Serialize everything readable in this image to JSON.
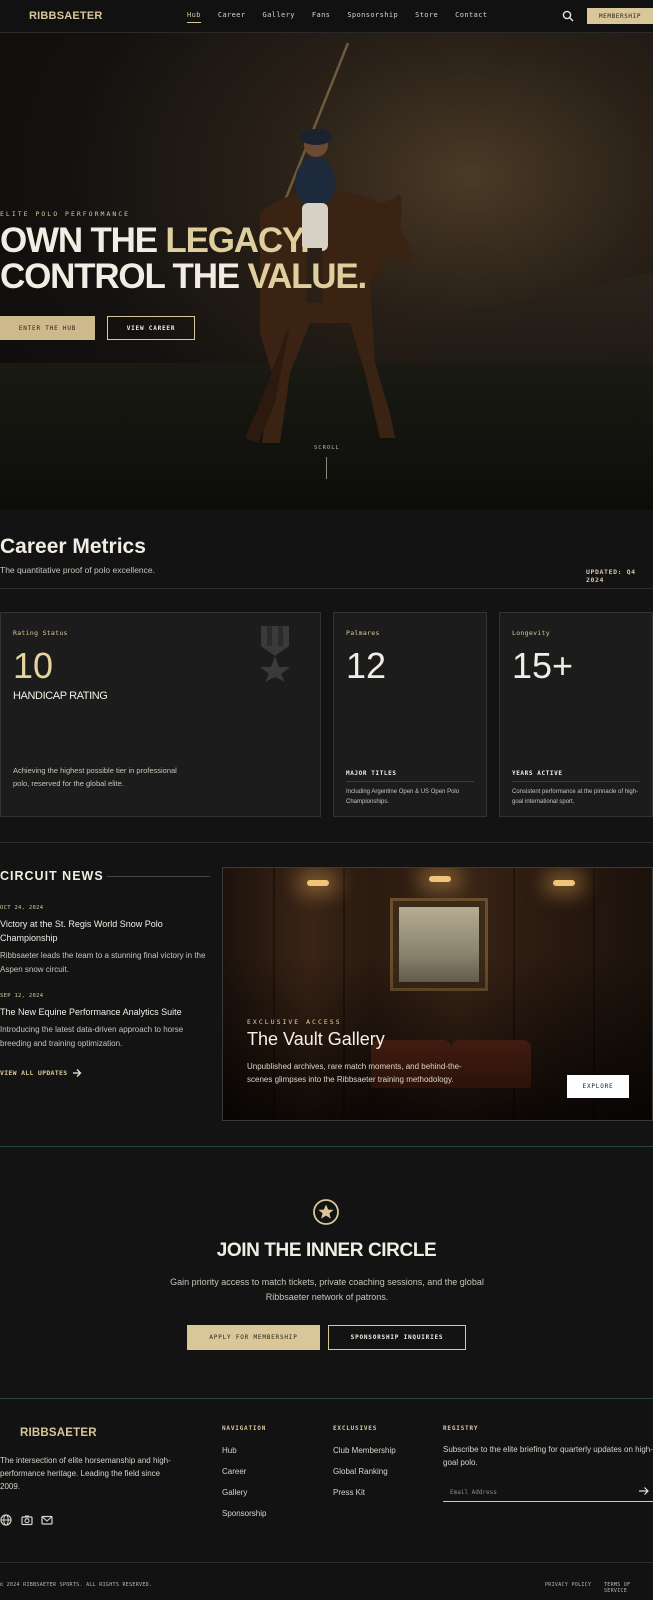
{
  "nav": {
    "brand": "RIBBSAETER",
    "links": [
      "Hub",
      "Career",
      "Gallery",
      "Fans",
      "Sponsorship",
      "Store",
      "Contact"
    ],
    "active_link": "Hub",
    "membership_label": "MEMBERSHIP",
    "search_icon": "search-icon"
  },
  "hero": {
    "eyebrow": "ELITE POLO PERFORMANCE",
    "title_line1_a": "OWN THE ",
    "title_line1_b": "LEGACY.",
    "title_line2_a": "CONTROL THE ",
    "title_line2_b": "VALUE.",
    "primary_cta": "ENTER THE HUB",
    "secondary_cta": "VIEW CAREER",
    "scroll_label": "SCROLL"
  },
  "metrics": {
    "title": "Career Metrics",
    "subtitle": "The quantitative proof of polo excellence.",
    "updated": "UPDATED: Q4 2024",
    "cards": [
      {
        "label": "Rating Status",
        "value": "10",
        "sublabel": "HANDICAP RATING",
        "description": "Achieving the highest possible tier in professional polo, reserved for the global elite.",
        "icon": "medal-icon"
      },
      {
        "label": "Palmares",
        "value": "12",
        "foot_title": "MAJOR TITLES",
        "foot_desc": "Including Argentine Open & US Open Polo Championships."
      },
      {
        "label": "Longevity",
        "value": "15+",
        "foot_title": "YEARS ACTIVE",
        "foot_desc": "Consistent performance at the pinnacle of high-goal international sport."
      }
    ]
  },
  "news": {
    "heading": "CIRCUIT NEWS",
    "items": [
      {
        "date": "OCT 24, 2024",
        "title": "Victory at the St. Regis World Snow Polo Championship",
        "description": "Ribbsaeter leads the team to a stunning final victory in the Aspen snow circuit."
      },
      {
        "date": "SEP 12, 2024",
        "title": "The New Equine Performance Analytics Suite",
        "description": "Introducing the latest data-driven approach to horse breeding and training optimization."
      }
    ],
    "view_all": "VIEW ALL UPDATES"
  },
  "vault": {
    "eyebrow": "EXCLUSIVE ACCESS",
    "title": "The Vault Gallery",
    "description": "Unpublished archives, rare match moments, and behind-the-scenes glimpses into the Ribbsaeter training methodology.",
    "cta": "EXPLORE"
  },
  "inner_circle": {
    "icon": "star-icon",
    "title": "JOIN THE INNER CIRCLE",
    "description": "Gain priority access to match tickets, private coaching sessions, and the global Ribbsaeter network of patrons.",
    "primary_cta": "APPLY FOR MEMBERSHIP",
    "secondary_cta": "SPONSORSHIP INQUIRIES"
  },
  "footer": {
    "brand": "RIBBSAETER",
    "description": "The intersection of elite horsemanship and high-performance heritage. Leading the field since 2009.",
    "social_icons": [
      "globe-icon",
      "camera-icon",
      "mail-icon"
    ],
    "navigation": {
      "heading": "NAVIGATION",
      "links": [
        "Hub",
        "Career",
        "Gallery",
        "Sponsorship"
      ]
    },
    "exclusives": {
      "heading": "EXCLUSIVES",
      "links": [
        "Club Membership",
        "Global Ranking",
        "Press Kit"
      ]
    },
    "registry": {
      "heading": "REGISTRY",
      "description": "Subscribe to the elite briefing for quarterly updates on high-goal polo.",
      "email_placeholder": "Email Address"
    },
    "copyright": "© 2024 RIBBSAETER SPORTS. ALL RIGHTS RESERVED.",
    "privacy": "PRIVACY POLICY",
    "terms": "TERMS OF SERVICE"
  }
}
